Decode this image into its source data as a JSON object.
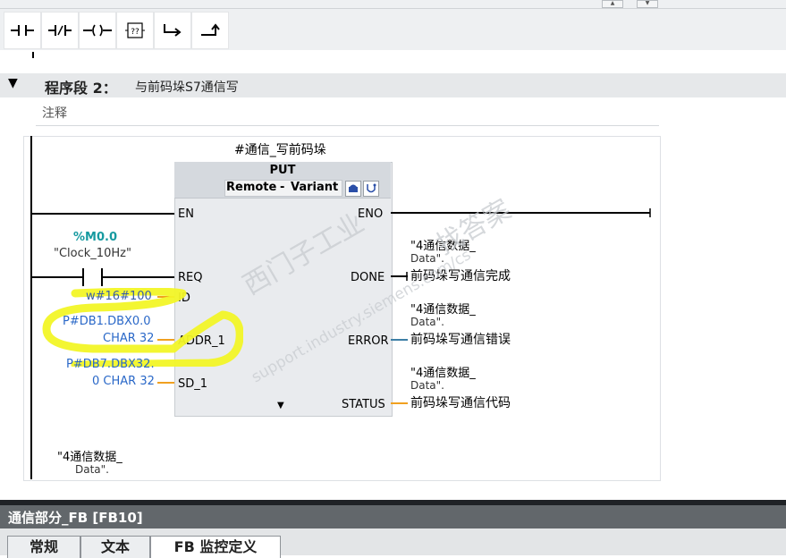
{
  "toolbar": {
    "buttons": [
      {
        "name": "no-contact-icon",
        "glyph": "⊣⊢"
      },
      {
        "name": "nc-contact-icon",
        "glyph": "⊣/⊢"
      },
      {
        "name": "coil-icon",
        "glyph": "–( )–"
      },
      {
        "name": "empty-box-icon",
        "glyph": "[??]"
      },
      {
        "name": "open-branch-icon",
        "glyph": "↳"
      },
      {
        "name": "close-branch-icon",
        "glyph": "↱"
      }
    ]
  },
  "network": {
    "title": "程序段 2：",
    "description": "与前码垛S7通信写",
    "comment": "注释"
  },
  "block": {
    "instance": "#通信_写前码垛",
    "name": "PUT",
    "params_a": "Remote",
    "params_sep": "-",
    "params_b": "Variant",
    "pins": {
      "en": "EN",
      "eno": "ENO",
      "req": "REQ",
      "id": "ID",
      "addr": "ADDR_1",
      "sd": "SD_1",
      "done": "DONE",
      "error": "ERROR",
      "status": "STATUS"
    }
  },
  "operands": {
    "contact_addr": "%M0.0",
    "contact_name": "\"Clock_10Hz\"",
    "id_value": "w#16#100",
    "addr_line1": "P#DB1.DBX0.0",
    "addr_line2": "CHAR 32",
    "sd_line1": "P#DB7.DBX32.",
    "sd_line2": "0 CHAR 32",
    "done_l1": "\"4通信数据_",
    "done_l2": "Data\".",
    "done_l3": "前码垛写通信完成",
    "error_l1": "\"4通信数据_",
    "error_l2": "Data\".",
    "error_l3": "前码垛写通信错误",
    "status_l1": "\"4通信数据_",
    "status_l2": "Data\".",
    "status_l3": "前码垛写通信代码",
    "bottom_l1": "\"4通信数据_",
    "bottom_l2": "Data\"."
  },
  "watermark": {
    "line1": "西门子工业",
    "line2": "support.industry.siemens.com/cs",
    "line3": "找答案"
  },
  "inspector": {
    "title": "通信部分_FB [FB10]",
    "tabs": [
      "常规",
      "文本",
      "FB 监控定义"
    ]
  },
  "colors": {
    "highlight": "#f2f527",
    "operand_blue": "#2a68c8",
    "address_teal": "#169aa0",
    "wire_orange": "#f0a020",
    "wire_blue": "#3d7fa6"
  }
}
